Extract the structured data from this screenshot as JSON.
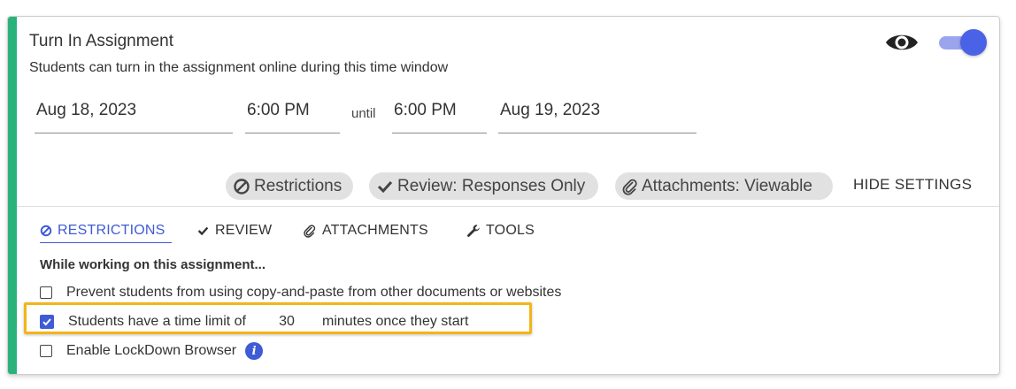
{
  "card": {
    "title": "Turn In Assignment",
    "subtitle": "Students can turn in the assignment online during this time window",
    "accent_color": "#2ab27b",
    "visibility_icon": "eye-icon",
    "toggle_on": true
  },
  "window": {
    "start_date": "Aug 18, 2023",
    "start_time": "6:00 PM",
    "until_label": "until",
    "end_time": "6:00 PM",
    "end_date": "Aug 19, 2023"
  },
  "chips": {
    "restrictions": "Restrictions",
    "review": "Review: Responses Only",
    "attachments": "Attachments: Viewable"
  },
  "hide_settings_label": "HIDE SETTINGS",
  "tabs": [
    {
      "label": "RESTRICTIONS",
      "icon": "ban-icon",
      "active": true
    },
    {
      "label": "REVIEW",
      "icon": "check-icon",
      "active": false
    },
    {
      "label": "ATTACHMENTS",
      "icon": "paperclip-icon",
      "active": false
    },
    {
      "label": "TOOLS",
      "icon": "wrench-icon",
      "active": false
    }
  ],
  "restrictions": {
    "heading": "While working on this assignment...",
    "prevent_copy_paste": {
      "label": "Prevent students from using copy-and-paste from other documents or websites",
      "checked": false
    },
    "time_limit": {
      "label_before": "Students have a time limit of",
      "value": "30",
      "label_after": "minutes once they start",
      "checked": true
    },
    "lockdown": {
      "label": "Enable LockDown Browser",
      "checked": false
    }
  },
  "colors": {
    "primary": "#3f5bd6",
    "highlight": "#f3b51b"
  }
}
